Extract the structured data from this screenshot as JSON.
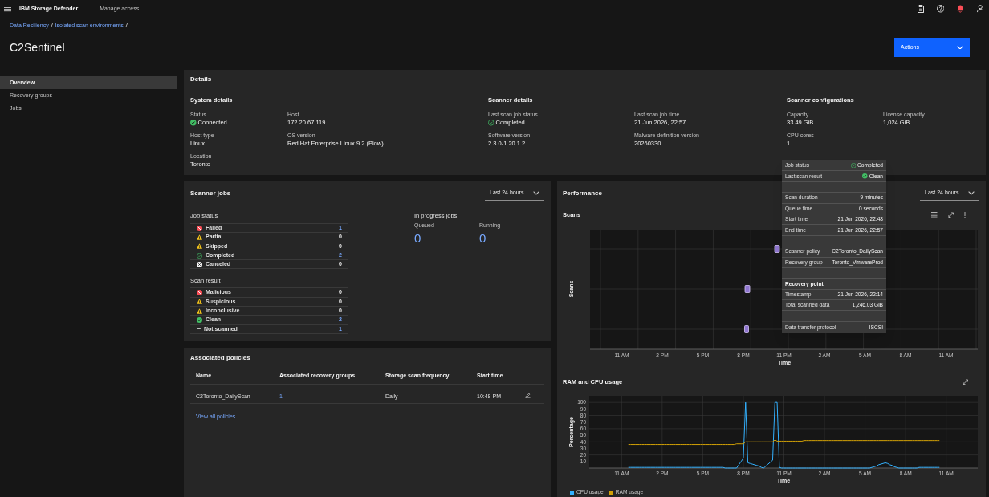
{
  "header": {
    "product": "IBM Storage Defender",
    "nav_link": "Manage access"
  },
  "breadcrumb": [
    {
      "label": "Data Resiliency",
      "separator": "/"
    },
    {
      "label": "Isolated scan environments",
      "separator": "/"
    }
  ],
  "page_title": "C2Sentinel",
  "actions_button": "Actions",
  "sidebar": {
    "items": [
      {
        "label": "Overview",
        "selected": true
      },
      {
        "label": "Recovery groups",
        "selected": false
      },
      {
        "label": "Jobs",
        "selected": false
      }
    ]
  },
  "details": {
    "title": "Details",
    "sections": [
      {
        "title": "System details",
        "fields": [
          {
            "kind": "success",
            "label": "Status",
            "value": "Connected"
          },
          {
            "kind": "plain",
            "label": "Host",
            "value": "172.20.67.119"
          },
          {
            "kind": "plain",
            "label": "Host type",
            "value": "Linux"
          },
          {
            "kind": "plain",
            "label": "OS version",
            "value": "Red Hat Enterprise Linux 9.2 (Plow)"
          },
          {
            "kind": "plain",
            "label": "Location",
            "value": "Toronto"
          }
        ]
      },
      {
        "title": "Scanner details",
        "fields": [
          {
            "kind": "completed",
            "label": "Last scan job status",
            "value": "Completed"
          },
          {
            "kind": "plain",
            "label": "Last scan job time",
            "value": "21 Jun 2026, 22:57"
          },
          {
            "kind": "plain",
            "label": "Software version",
            "value": "2.3.0-1.20.1.2"
          },
          {
            "kind": "plain",
            "label": "Malware definition version",
            "value": "20260330"
          }
        ]
      },
      {
        "title": "Scanner configurations",
        "fields": [
          {
            "kind": "plain",
            "label": "Capacity",
            "value": "33.49 GiB"
          },
          {
            "kind": "plain",
            "label": "License capacity",
            "value": "1,024 GiB"
          },
          {
            "kind": "plain",
            "label": "CPU cores",
            "value": "1"
          }
        ]
      }
    ]
  },
  "scanner_jobs": {
    "title": "Scanner jobs",
    "range": "Last 24 hours",
    "groups": [
      {
        "title": "Job status",
        "rows": [
          {
            "kind": "error",
            "label": "Failed",
            "count": "1",
            "link": true
          },
          {
            "kind": "warning",
            "label": "Partial",
            "count": "0",
            "link": false
          },
          {
            "kind": "warning",
            "label": "Skipped",
            "count": "0",
            "link": false
          },
          {
            "kind": "completed",
            "label": "Completed",
            "count": "2",
            "link": true
          },
          {
            "kind": "canceled",
            "label": "Canceled",
            "count": "0",
            "link": false
          }
        ]
      },
      {
        "title": "Scan result",
        "rows": [
          {
            "kind": "error",
            "label": "Malicious",
            "count": "0",
            "link": false
          },
          {
            "kind": "warning",
            "label": "Suspicious",
            "count": "0",
            "link": false
          },
          {
            "kind": "warning",
            "label": "Inconclusive",
            "count": "0",
            "link": false
          },
          {
            "kind": "success",
            "label": "Clean",
            "count": "2",
            "link": true
          },
          {
            "kind": "dash",
            "label": "Not scanned",
            "count": "1",
            "link": true
          }
        ]
      }
    ],
    "in_progress": {
      "title": "In progress jobs",
      "stats": [
        {
          "label": "Queued",
          "value": "0"
        },
        {
          "label": "Running",
          "value": "0"
        }
      ]
    }
  },
  "associated_policies": {
    "title": "Associated policies",
    "columns": [
      "Name",
      "Associated recovery groups",
      "Storage scan frequency",
      "Start time"
    ],
    "rows": [
      {
        "cells": [
          {
            "text": "C2Toronto_DailyScan",
            "link": false
          },
          {
            "text": "1",
            "link": true
          },
          {
            "text": "Daily",
            "link": false
          },
          {
            "text": "10:48 PM",
            "link": false
          }
        ]
      }
    ],
    "view_all_link": "View all policies"
  },
  "performance": {
    "title": "Performance",
    "range": "Last 24 hours",
    "scans": {
      "title": "Scans",
      "ylabel": "Scans",
      "xlabel": "Time",
      "xticks": [
        "11 AM",
        "2 PM",
        "5 PM",
        "8 PM",
        "11 PM",
        "2 AM",
        "5 AM",
        "8 AM",
        "11 AM"
      ]
    },
    "usage": {
      "title": "RAM and CPU usage",
      "chart_data": {
        "type": "line",
        "grid": true,
        "xlabel": "Time",
        "ylabel": "Percentage",
        "categories": [
          "11 AM",
          null,
          null,
          null,
          null,
          null,
          null,
          null,
          null,
          null,
          null,
          null,
          null,
          null,
          null,
          null,
          null,
          null,
          "2 PM",
          null,
          null,
          null,
          null,
          null,
          null,
          null,
          null,
          null,
          null,
          null,
          null,
          null,
          null,
          null,
          null,
          null,
          "5 PM",
          null,
          null,
          null,
          null,
          null,
          null,
          null,
          null,
          null,
          null,
          null,
          null,
          null,
          null,
          null,
          null,
          null,
          "8 PM",
          null,
          null,
          null,
          null,
          null,
          null,
          null,
          null,
          null,
          null,
          null,
          null,
          null,
          null,
          null,
          null,
          null,
          "11 PM",
          null,
          null,
          null,
          null,
          null,
          null,
          null,
          null,
          null,
          null,
          null,
          null,
          null,
          null,
          null,
          null,
          null,
          "2 AM",
          null,
          null,
          null,
          null,
          null,
          null,
          null,
          null,
          null,
          null,
          null,
          null,
          null,
          null,
          null,
          null,
          null,
          "5 AM",
          null,
          null,
          null,
          null,
          null,
          null,
          null,
          null,
          null,
          null,
          null,
          null,
          null,
          null,
          null,
          null,
          null,
          "8 AM",
          null,
          null,
          null,
          null,
          null,
          null,
          null,
          null,
          null,
          null,
          null,
          null,
          null,
          null,
          null,
          null,
          null,
          "11 AM"
        ],
        "series": [
          {
            "name": "CPU usage",
            "color": "#33b1ff",
            "values": [
              null,
              null,
              null,
              1,
              1,
              1,
              1,
              1,
              1,
              1,
              1,
              1,
              1,
              1,
              1,
              1,
              1,
              1,
              1,
              1,
              1,
              1,
              1,
              1,
              1,
              1,
              1,
              1,
              1,
              1,
              1,
              1,
              1,
              1,
              1,
              1,
              1,
              1,
              1,
              1,
              1,
              1,
              1,
              1,
              1,
              1,
              0,
              0,
              0,
              0,
              0,
              0,
              5,
              10,
              15,
              100,
              8,
              7,
              6,
              5,
              4,
              3,
              1,
              0,
              3,
              6,
              9,
              12,
              100,
              100,
              1,
              0,
              0,
              0,
              0,
              0,
              0,
              0,
              0,
              0,
              0,
              0,
              0,
              0,
              0,
              0,
              0,
              0,
              0,
              0,
              0,
              0,
              0,
              0,
              0,
              0,
              0,
              0,
              0,
              0,
              0,
              0,
              0,
              0,
              0,
              0,
              0,
              0,
              0,
              0,
              0,
              1,
              2,
              3,
              5,
              6,
              7,
              8,
              7,
              5,
              4,
              2,
              1,
              0,
              0,
              0,
              0,
              0,
              0,
              0,
              0,
              0,
              1,
              1,
              1,
              1,
              1,
              1,
              1,
              1,
              1,
              1,
              null,
              null,
              null
            ]
          },
          {
            "name": "RAM usage",
            "color": "#d2a106",
            "values": [
              null,
              null,
              null,
              36,
              36,
              36,
              36,
              36,
              36,
              36,
              36,
              36,
              36,
              36,
              36,
              36,
              36,
              36,
              36,
              36,
              36,
              36,
              36,
              36,
              36,
              36,
              36,
              36,
              36,
              36,
              36,
              36,
              36,
              36,
              36,
              36,
              36,
              36,
              36,
              36,
              36,
              36,
              36,
              36,
              36,
              36,
              36,
              36,
              36,
              36,
              36,
              37,
              37,
              37,
              37,
              40,
              40,
              40,
              40,
              40,
              40,
              40,
              40,
              40,
              40,
              40,
              40,
              40,
              43,
              41,
              41,
              41,
              41,
              41,
              41,
              41,
              41,
              41,
              41,
              41,
              41,
              42,
              42,
              42,
              42,
              42,
              42,
              42,
              42,
              42,
              42,
              42,
              42,
              42,
              42,
              42,
              42,
              42,
              42,
              42,
              42,
              42,
              42,
              42,
              42,
              42,
              42,
              42,
              42,
              42,
              42,
              42,
              42,
              42,
              42,
              42,
              42,
              42,
              42,
              42,
              42,
              42,
              42,
              42,
              42,
              42,
              42,
              42,
              42,
              42,
              42,
              42,
              42,
              42,
              42,
              42,
              42,
              42,
              42,
              42,
              42,
              42,
              null,
              null,
              null
            ]
          }
        ],
        "ylim": [
          0,
          110
        ],
        "yticks": [
          10,
          20,
          30,
          40,
          50,
          60,
          70,
          80,
          90,
          100
        ]
      }
    }
  },
  "tooltip": {
    "rows": [
      {
        "kind": "completed",
        "label": "Job status",
        "value": "Completed"
      },
      {
        "kind": "success",
        "label": "Last scan result",
        "value": "Clean"
      },
      {
        "kind": "spacer"
      },
      {
        "kind": "field",
        "label": "Scan duration",
        "value": "9 minutes"
      },
      {
        "kind": "field",
        "label": "Queue time",
        "value": "0 seconds"
      },
      {
        "kind": "field",
        "label": "Start time",
        "value": "21 Jun 2026, 22:48"
      },
      {
        "kind": "field",
        "label": "End time",
        "value": "21 Jun 2026, 22:57"
      },
      {
        "kind": "spacer"
      },
      {
        "kind": "field",
        "label": "Scanner policy",
        "value": "C2Toronto_DailyScan"
      },
      {
        "kind": "field",
        "label": "Recovery group",
        "value": "Toronto_VmwareProd"
      },
      {
        "kind": "spacer"
      },
      {
        "kind": "heading",
        "label": "Recovery point"
      },
      {
        "kind": "field",
        "label": "Timestamp",
        "value": "21 Jun 2026, 22:14"
      },
      {
        "kind": "field",
        "label": "Total scanned data",
        "value": "1,246.03 GiB"
      },
      {
        "kind": "spacer"
      },
      {
        "kind": "field",
        "label": "Data transfer protocol",
        "value": "ISCSI"
      }
    ]
  }
}
